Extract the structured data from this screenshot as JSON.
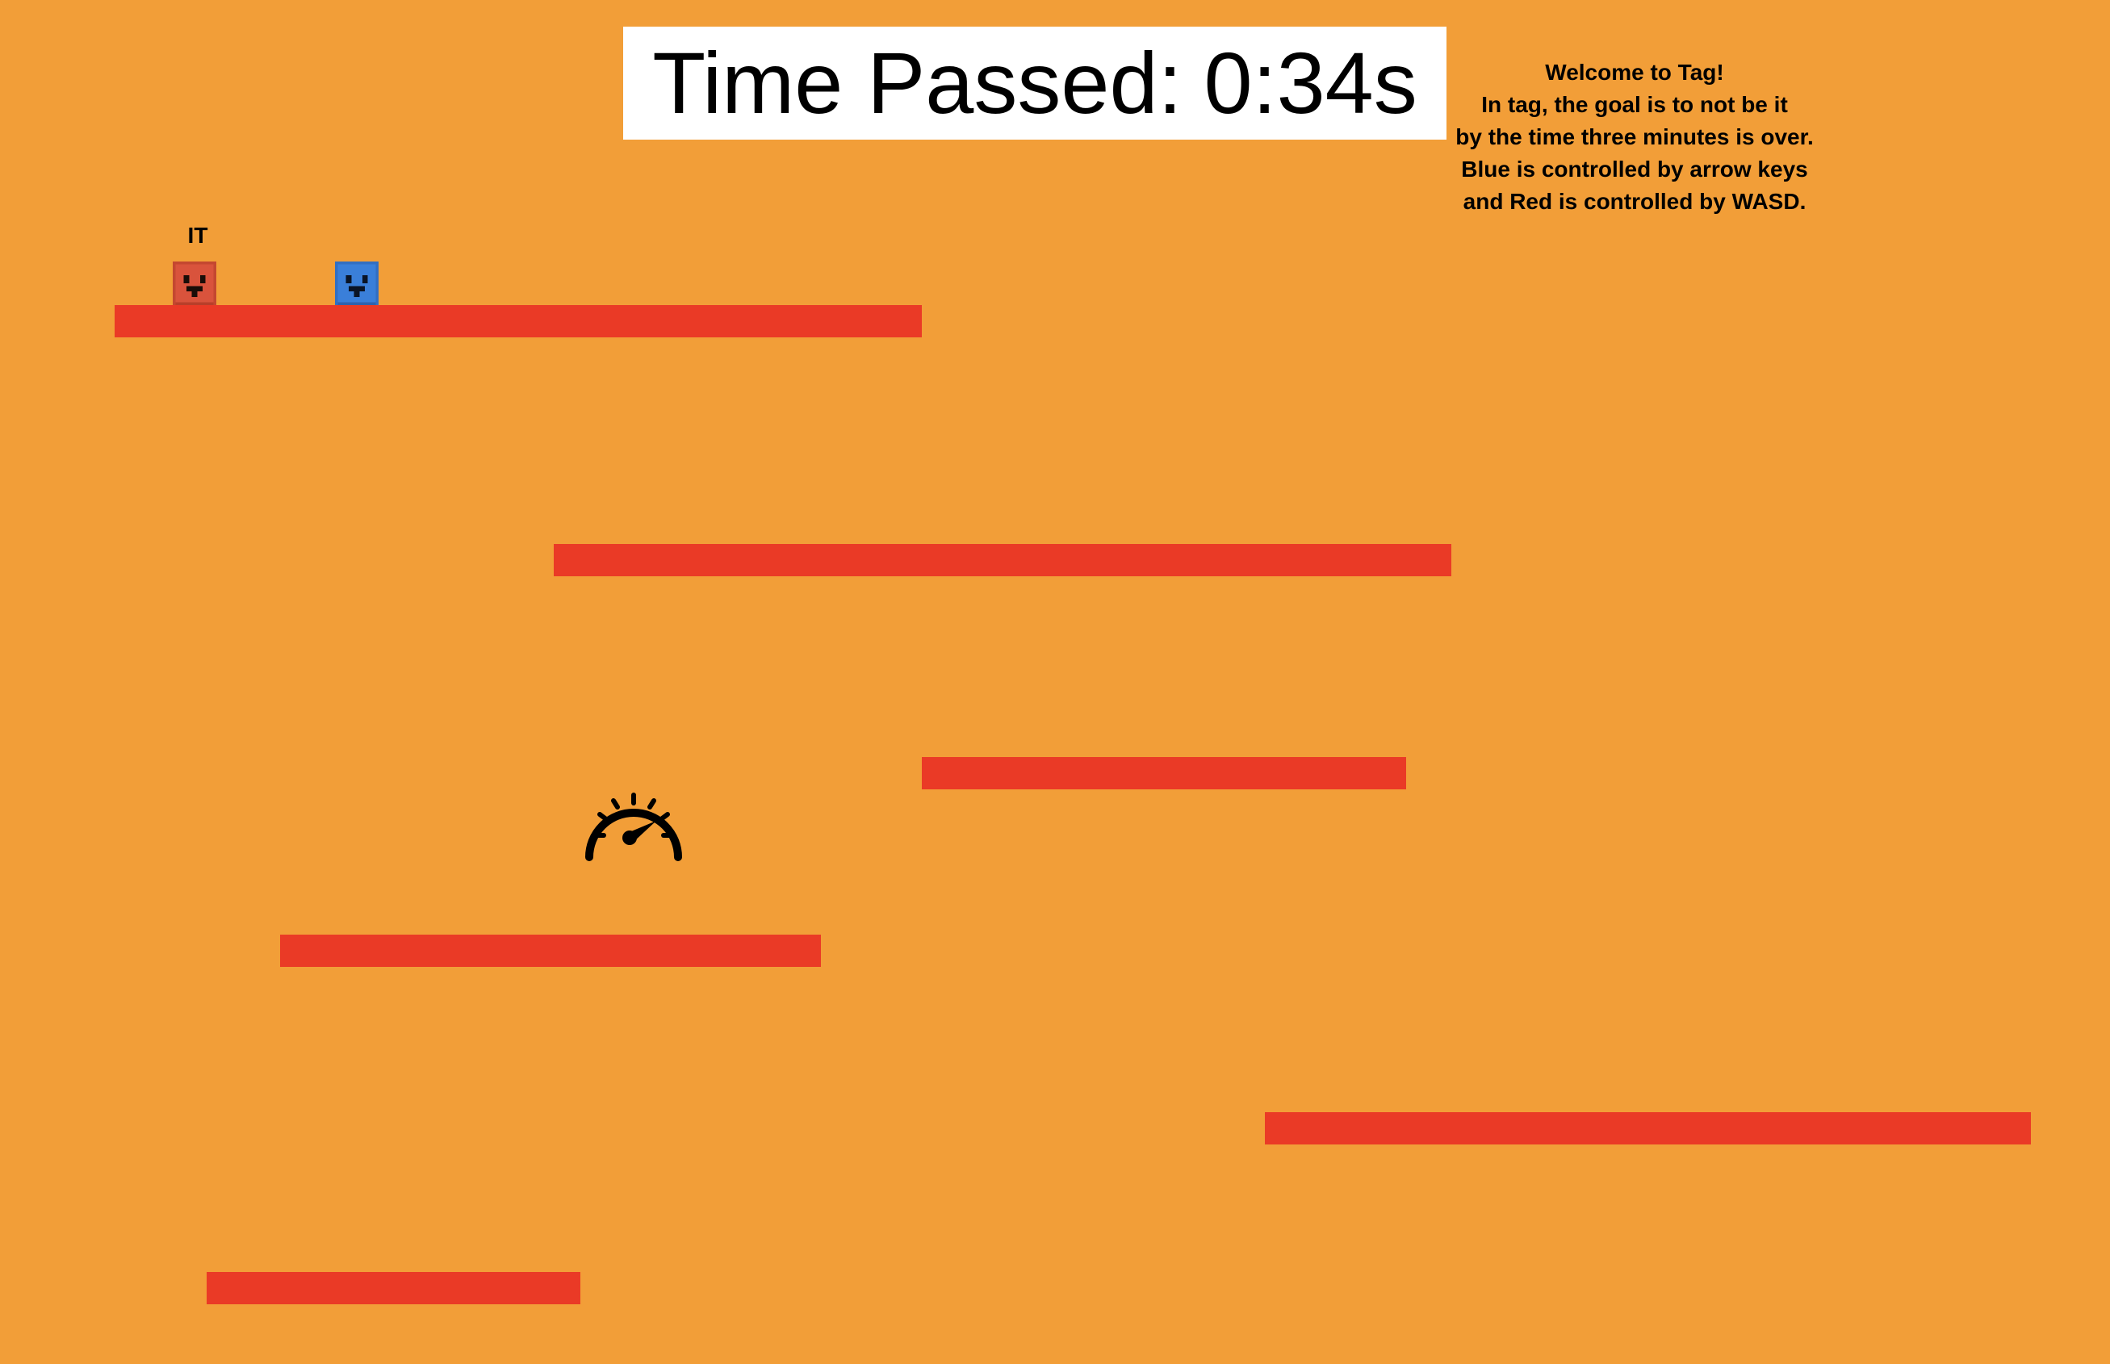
{
  "game": {
    "background_color": "#f29e38",
    "platform_color": "#ea3a26",
    "timer": {
      "label": "Time Passed:",
      "value": "0:34s"
    },
    "instructions": [
      "Welcome to Tag!",
      "In tag, the goal is to not be it",
      "by the time three minutes is over.",
      "Blue is controlled by arrow keys",
      "and Red is controlled by WASD."
    ],
    "players": {
      "red": {
        "color": "#d9533c",
        "tag_label": "IT"
      },
      "blue": {
        "color": "#3a7fd9"
      }
    },
    "powerup": {
      "icon": "speedometer-icon"
    },
    "platform_count": 6
  }
}
